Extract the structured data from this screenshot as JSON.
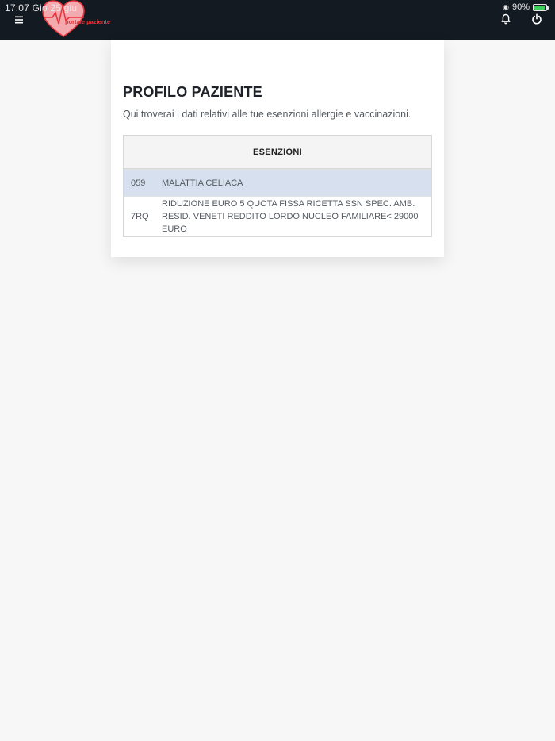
{
  "status_bar": {
    "time": "17:07  Gio 25 giu",
    "battery": "90%"
  },
  "header": {
    "logo_text": "portale paziente"
  },
  "profile": {
    "title": "PROFILO PAZIENTE",
    "subtitle": "Qui troverai i dati relativi alle tue esenzioni allergie e vaccinazioni."
  },
  "exemptions": {
    "header": "ESENZIONI",
    "rows": [
      {
        "code": "059",
        "description": "MALATTIA CELIACA"
      },
      {
        "code": "7RQ",
        "description": "RIDUZIONE EURO 5 QUOTA FISSA RICETTA SSN SPEC. AMB. RESID. VENETI REDDITO LORDO NUCLEO FAMILIARE< 29000 EURO"
      }
    ]
  },
  "colors": {
    "topbar": "#141a22",
    "accent": "#e8343c",
    "selected_row": "#d6e0ee"
  }
}
